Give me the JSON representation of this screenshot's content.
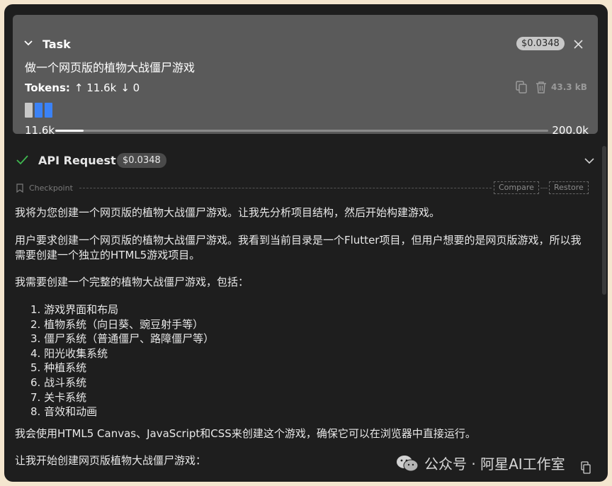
{
  "task": {
    "title": "Task",
    "cost": "$0.0348",
    "description": "做一个网页版的植物大战僵尸游戏",
    "tokens_label": "Tokens:",
    "tokens_in": "↑ 11.6k",
    "tokens_out": "↓ 0",
    "size": "43.3 kB",
    "context_used": "11.6k",
    "context_max": "200.0k",
    "context_fraction": 0.058,
    "bar_colors": [
      "#c8c8c8",
      "#3b82f6",
      "#3b82f6"
    ]
  },
  "api_request": {
    "title": "API Request",
    "cost": "$0.0348",
    "status_color": "#3fb950"
  },
  "checkpoint": {
    "label": "Checkpoint",
    "compare": "Compare",
    "restore": "Restore"
  },
  "message": {
    "intro": "我将为您创建一个网页版的植物大战僵尸游戏。让我先分析项目结构，然后开始构建游戏。",
    "para2": "用户要求创建一个网页版的植物大战僵尸游戏。我看到当前目录是一个Flutter项目，但用户想要的是网页版游戏，所以我需要创建一个独立的HTML5游戏项目。",
    "para3": "我需要创建一个完整的植物大战僵尸游戏，包括：",
    "list": [
      "1. 游戏界面和布局",
      "2. 植物系统（向日葵、豌豆射手等）",
      "3. 僵尸系统（普通僵尸、路障僵尸等）",
      "4. 阳光收集系统",
      "5. 种植系统",
      "6. 战斗系统",
      "7. 关卡系统",
      "8. 音效和动画"
    ],
    "para4": "我会使用HTML5 Canvas、JavaScript和CSS来创建这个游戏，确保它可以在浏览器中直接运行。",
    "para5": "让我开始创建网页版植物大战僵尸游戏："
  },
  "watermark": {
    "text": "公众号 · 阿星AI工作室"
  }
}
